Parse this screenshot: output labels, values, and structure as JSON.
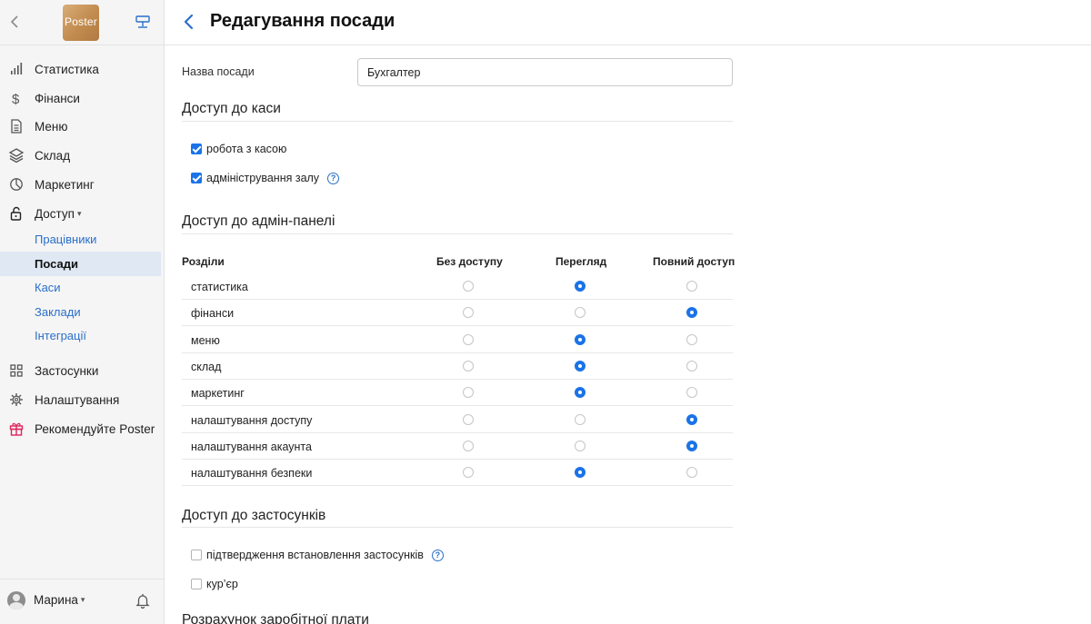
{
  "app": {
    "logo_text": "Poster"
  },
  "sidebar": {
    "items": [
      {
        "label": "Статистика"
      },
      {
        "label": "Фінанси"
      },
      {
        "label": "Меню"
      },
      {
        "label": "Склад"
      },
      {
        "label": "Маркетинг"
      },
      {
        "label": "Доступ",
        "expanded": true
      }
    ],
    "sub_items": [
      {
        "label": "Працівники",
        "active": false
      },
      {
        "label": "Посади",
        "active": true
      },
      {
        "label": "Каси",
        "active": false
      },
      {
        "label": "Заклади",
        "active": false
      },
      {
        "label": "Інтеграції",
        "active": false
      }
    ],
    "bottom_items": [
      {
        "label": "Застосунки"
      },
      {
        "label": "Налаштування"
      },
      {
        "label": "Рекомендуйте Poster"
      }
    ],
    "user": {
      "name": "Марина"
    }
  },
  "header": {
    "title": "Редагування посади"
  },
  "form": {
    "position_label": "Назва посади",
    "position_value": "Бухгалтер"
  },
  "cash_access": {
    "title": "Доступ до каси",
    "options": [
      {
        "label": "робота з касою",
        "checked": true,
        "help": false
      },
      {
        "label": "адміністрування залу",
        "checked": true,
        "help": true
      }
    ]
  },
  "admin_access": {
    "title": "Доступ до адмін-панелі",
    "columns": [
      "Розділи",
      "Без доступу",
      "Перегляд",
      "Повний доступ"
    ],
    "rows": [
      {
        "name": "статистика",
        "level": "Перегляд"
      },
      {
        "name": "фінанси",
        "level": "Повний доступ"
      },
      {
        "name": "меню",
        "level": "Перегляд"
      },
      {
        "name": "склад",
        "level": "Перегляд"
      },
      {
        "name": "маркетинг",
        "level": "Перегляд"
      },
      {
        "name": "налаштування доступу",
        "level": "Повний доступ"
      },
      {
        "name": "налаштування акаунта",
        "level": "Повний доступ"
      },
      {
        "name": "налаштування безпеки",
        "level": "Перегляд"
      }
    ]
  },
  "apps_access": {
    "title": "Доступ до застосунків",
    "options": [
      {
        "label": "підтвердження встановлення застосунків",
        "checked": false,
        "help": true
      },
      {
        "label": "кур’єр",
        "checked": false,
        "help": false
      }
    ]
  },
  "salary": {
    "title": "Розрахунок заробітної плати"
  },
  "colors": {
    "accent": "#1a73e8",
    "link": "#2a6fc9",
    "active_bg": "#dfe8f3",
    "sidebar_bg": "#f5f5f5"
  }
}
